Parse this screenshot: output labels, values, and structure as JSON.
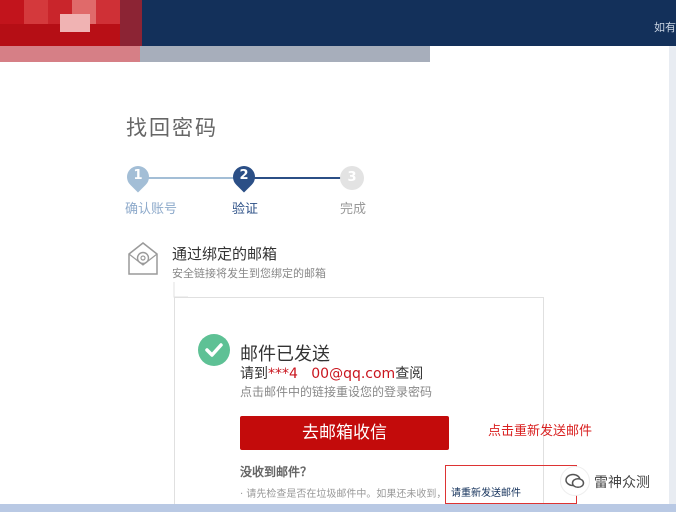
{
  "header": {
    "top_right_text": "如有"
  },
  "page": {
    "title": "找回密码"
  },
  "steps": [
    {
      "number": "1",
      "label": "确认账号",
      "state": "done"
    },
    {
      "number": "2",
      "label": "验证",
      "state": "current"
    },
    {
      "number": "3",
      "label": "完成",
      "state": "todo"
    }
  ],
  "method": {
    "title": "通过绑定的邮箱",
    "subtitle": "安全链接将发生到您绑定的邮箱",
    "icon": "mail-at-icon"
  },
  "result": {
    "title": "邮件已发送",
    "line_prefix": "请到",
    "masked_email": "***4   00@qq.com",
    "line_suffix": "查阅",
    "hint": "点击邮件中的链接重设您的登录密码",
    "go_button": "去邮箱收信",
    "not_received": "没收到邮件？",
    "tip": "· 请先检查是否在垃圾邮件中。如果还未收到，",
    "resend_link": "请重新发送邮件"
  },
  "annotation": {
    "text": "点击重新发送邮件"
  },
  "watermark": {
    "text": "雷神众测"
  },
  "colors": {
    "header": "#13305a",
    "step_done": "#a3bed6",
    "step_current": "#2b4f86",
    "step_todo": "#e3e3e3",
    "primary_button": "#c30b0b",
    "success": "#5ec195",
    "annotation": "#d91f1f"
  }
}
